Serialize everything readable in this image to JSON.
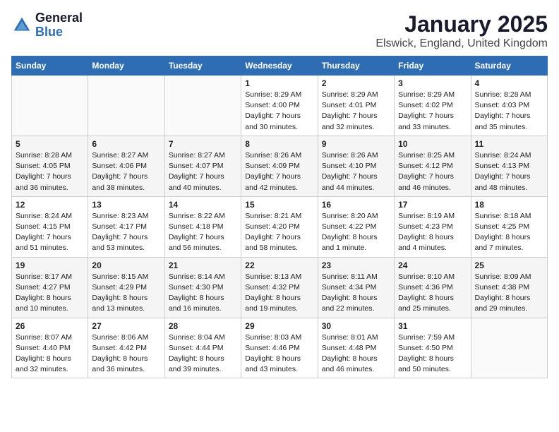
{
  "header": {
    "logo_line1": "General",
    "logo_line2": "Blue",
    "month_title": "January 2025",
    "location": "Elswick, England, United Kingdom"
  },
  "weekdays": [
    "Sunday",
    "Monday",
    "Tuesday",
    "Wednesday",
    "Thursday",
    "Friday",
    "Saturday"
  ],
  "weeks": [
    [
      {
        "day": "",
        "info": ""
      },
      {
        "day": "",
        "info": ""
      },
      {
        "day": "",
        "info": ""
      },
      {
        "day": "1",
        "info": "Sunrise: 8:29 AM\nSunset: 4:00 PM\nDaylight: 7 hours\nand 30 minutes."
      },
      {
        "day": "2",
        "info": "Sunrise: 8:29 AM\nSunset: 4:01 PM\nDaylight: 7 hours\nand 32 minutes."
      },
      {
        "day": "3",
        "info": "Sunrise: 8:29 AM\nSunset: 4:02 PM\nDaylight: 7 hours\nand 33 minutes."
      },
      {
        "day": "4",
        "info": "Sunrise: 8:28 AM\nSunset: 4:03 PM\nDaylight: 7 hours\nand 35 minutes."
      }
    ],
    [
      {
        "day": "5",
        "info": "Sunrise: 8:28 AM\nSunset: 4:05 PM\nDaylight: 7 hours\nand 36 minutes."
      },
      {
        "day": "6",
        "info": "Sunrise: 8:27 AM\nSunset: 4:06 PM\nDaylight: 7 hours\nand 38 minutes."
      },
      {
        "day": "7",
        "info": "Sunrise: 8:27 AM\nSunset: 4:07 PM\nDaylight: 7 hours\nand 40 minutes."
      },
      {
        "day": "8",
        "info": "Sunrise: 8:26 AM\nSunset: 4:09 PM\nDaylight: 7 hours\nand 42 minutes."
      },
      {
        "day": "9",
        "info": "Sunrise: 8:26 AM\nSunset: 4:10 PM\nDaylight: 7 hours\nand 44 minutes."
      },
      {
        "day": "10",
        "info": "Sunrise: 8:25 AM\nSunset: 4:12 PM\nDaylight: 7 hours\nand 46 minutes."
      },
      {
        "day": "11",
        "info": "Sunrise: 8:24 AM\nSunset: 4:13 PM\nDaylight: 7 hours\nand 48 minutes."
      }
    ],
    [
      {
        "day": "12",
        "info": "Sunrise: 8:24 AM\nSunset: 4:15 PM\nDaylight: 7 hours\nand 51 minutes."
      },
      {
        "day": "13",
        "info": "Sunrise: 8:23 AM\nSunset: 4:17 PM\nDaylight: 7 hours\nand 53 minutes."
      },
      {
        "day": "14",
        "info": "Sunrise: 8:22 AM\nSunset: 4:18 PM\nDaylight: 7 hours\nand 56 minutes."
      },
      {
        "day": "15",
        "info": "Sunrise: 8:21 AM\nSunset: 4:20 PM\nDaylight: 7 hours\nand 58 minutes."
      },
      {
        "day": "16",
        "info": "Sunrise: 8:20 AM\nSunset: 4:22 PM\nDaylight: 8 hours\nand 1 minute."
      },
      {
        "day": "17",
        "info": "Sunrise: 8:19 AM\nSunset: 4:23 PM\nDaylight: 8 hours\nand 4 minutes."
      },
      {
        "day": "18",
        "info": "Sunrise: 8:18 AM\nSunset: 4:25 PM\nDaylight: 8 hours\nand 7 minutes."
      }
    ],
    [
      {
        "day": "19",
        "info": "Sunrise: 8:17 AM\nSunset: 4:27 PM\nDaylight: 8 hours\nand 10 minutes."
      },
      {
        "day": "20",
        "info": "Sunrise: 8:15 AM\nSunset: 4:29 PM\nDaylight: 8 hours\nand 13 minutes."
      },
      {
        "day": "21",
        "info": "Sunrise: 8:14 AM\nSunset: 4:30 PM\nDaylight: 8 hours\nand 16 minutes."
      },
      {
        "day": "22",
        "info": "Sunrise: 8:13 AM\nSunset: 4:32 PM\nDaylight: 8 hours\nand 19 minutes."
      },
      {
        "day": "23",
        "info": "Sunrise: 8:11 AM\nSunset: 4:34 PM\nDaylight: 8 hours\nand 22 minutes."
      },
      {
        "day": "24",
        "info": "Sunrise: 8:10 AM\nSunset: 4:36 PM\nDaylight: 8 hours\nand 25 minutes."
      },
      {
        "day": "25",
        "info": "Sunrise: 8:09 AM\nSunset: 4:38 PM\nDaylight: 8 hours\nand 29 minutes."
      }
    ],
    [
      {
        "day": "26",
        "info": "Sunrise: 8:07 AM\nSunset: 4:40 PM\nDaylight: 8 hours\nand 32 minutes."
      },
      {
        "day": "27",
        "info": "Sunrise: 8:06 AM\nSunset: 4:42 PM\nDaylight: 8 hours\nand 36 minutes."
      },
      {
        "day": "28",
        "info": "Sunrise: 8:04 AM\nSunset: 4:44 PM\nDaylight: 8 hours\nand 39 minutes."
      },
      {
        "day": "29",
        "info": "Sunrise: 8:03 AM\nSunset: 4:46 PM\nDaylight: 8 hours\nand 43 minutes."
      },
      {
        "day": "30",
        "info": "Sunrise: 8:01 AM\nSunset: 4:48 PM\nDaylight: 8 hours\nand 46 minutes."
      },
      {
        "day": "31",
        "info": "Sunrise: 7:59 AM\nSunset: 4:50 PM\nDaylight: 8 hours\nand 50 minutes."
      },
      {
        "day": "",
        "info": ""
      }
    ]
  ]
}
